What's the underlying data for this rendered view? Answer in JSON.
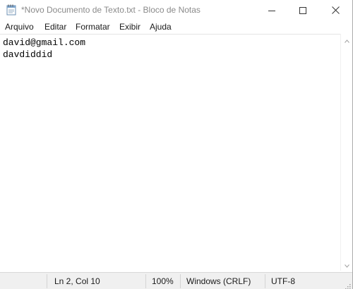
{
  "window": {
    "title": "*Novo Documento de Texto.txt - Bloco de Notas",
    "app_icon": "notepad-icon",
    "controls": {
      "minimize_icon": "minimize-icon",
      "maximize_icon": "maximize-icon",
      "close_icon": "close-icon"
    }
  },
  "menu": {
    "items": [
      "Arquivo",
      "Editar",
      "Formatar",
      "Exibir",
      "Ajuda"
    ]
  },
  "editor": {
    "lines": [
      "david@gmail.com",
      "davdiddid"
    ]
  },
  "scrollbar": {
    "up_icon": "scroll-up-arrow-icon",
    "down_icon": "scroll-down-arrow-icon"
  },
  "status": {
    "position": "Ln 2, Col 10",
    "zoom": "100%",
    "line_ending": "Windows (CRLF)",
    "encoding": "UTF-8"
  }
}
